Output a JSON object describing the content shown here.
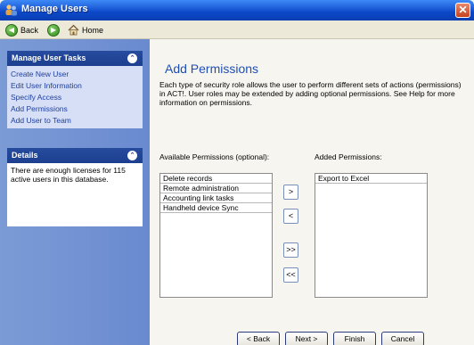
{
  "window": {
    "title": "Manage Users",
    "close_glyph": "✕"
  },
  "nav": {
    "back_label": "Back",
    "back_glyph": "◀",
    "forward_glyph": "▶",
    "home_label": "Home"
  },
  "sidebar": {
    "tasks_header": "Manage User Tasks",
    "collapse_glyph": "⌃",
    "tasks": [
      {
        "label": "Create New User"
      },
      {
        "label": "Edit User Information"
      },
      {
        "label": "Specify Access"
      },
      {
        "label": "Add Permissions"
      },
      {
        "label": "Add User to Team"
      }
    ],
    "details_header": "Details",
    "details_text": "There are enough licenses for 115 active users in this database."
  },
  "main": {
    "heading": "Add Permissions",
    "description": "Each type of security role allows the user to perform different sets of actions (permissions) in ACT!. User roles may be extended by adding optional permissions. See Help for more information on permissions.",
    "available_label": "Available Permissions (optional):",
    "added_label": "Added Permissions:",
    "available": [
      "Delete records",
      "Remote administration",
      "Accounting link tasks",
      "Handheld device Sync"
    ],
    "added": [
      "Export to Excel"
    ],
    "move_buttons": {
      "add": ">",
      "remove": "<",
      "add_all": ">>",
      "remove_all": "<<"
    }
  },
  "footer": {
    "back": "< Back",
    "next": "Next >",
    "finish": "Finish",
    "cancel": "Cancel"
  }
}
